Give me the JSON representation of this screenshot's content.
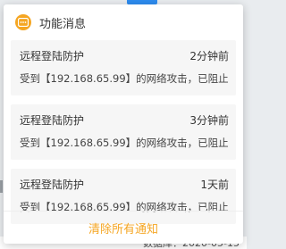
{
  "header": {
    "title": "功能消息",
    "icon": "message-icon",
    "icon_color": "#f5a623"
  },
  "notices": [
    {
      "title": "远程登陆防护",
      "time": "2分钟前",
      "message": "受到【192.168.65.99】的网络攻击，已阻止"
    },
    {
      "title": "远程登陆防护",
      "time": "3分钟前",
      "message": "受到【192.168.65.99】的网络攻击，已阻止"
    },
    {
      "title": "远程登陆防护",
      "time": "1天前",
      "message": "受到【192.168.65.99】的网络攻击，已阻止"
    }
  ],
  "footer": {
    "clear_label": "清除所有通知",
    "accent_color": "#f5a623"
  },
  "background": {
    "partial_text": "数据库：2020-05-15"
  }
}
